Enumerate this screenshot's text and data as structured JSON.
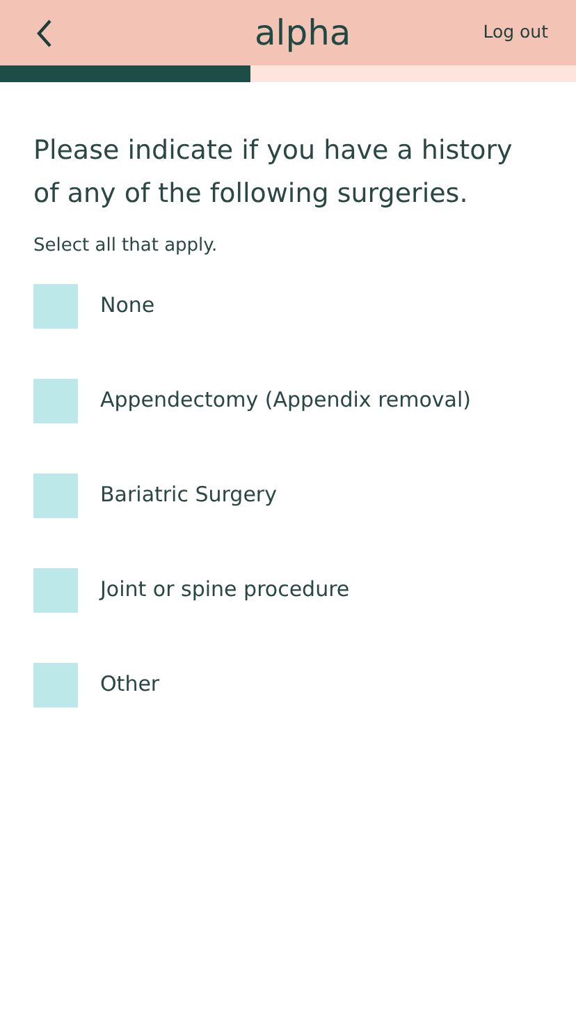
{
  "header": {
    "logo": "alpha",
    "logout": "Log out"
  },
  "progress": {
    "level": 0.435
  },
  "question": "Please indicate if you have a history of any of the following surgeries.",
  "hint": "Select all that apply.",
  "options": [
    {
      "label": "None",
      "checked": false
    },
    {
      "label": "Appendectomy (Appendix removal)",
      "checked": false
    },
    {
      "label": "Bariatric Surgery",
      "checked": false
    },
    {
      "label": "Joint or spine procedure",
      "checked": false
    },
    {
      "label": "Other",
      "checked": false
    }
  ]
}
